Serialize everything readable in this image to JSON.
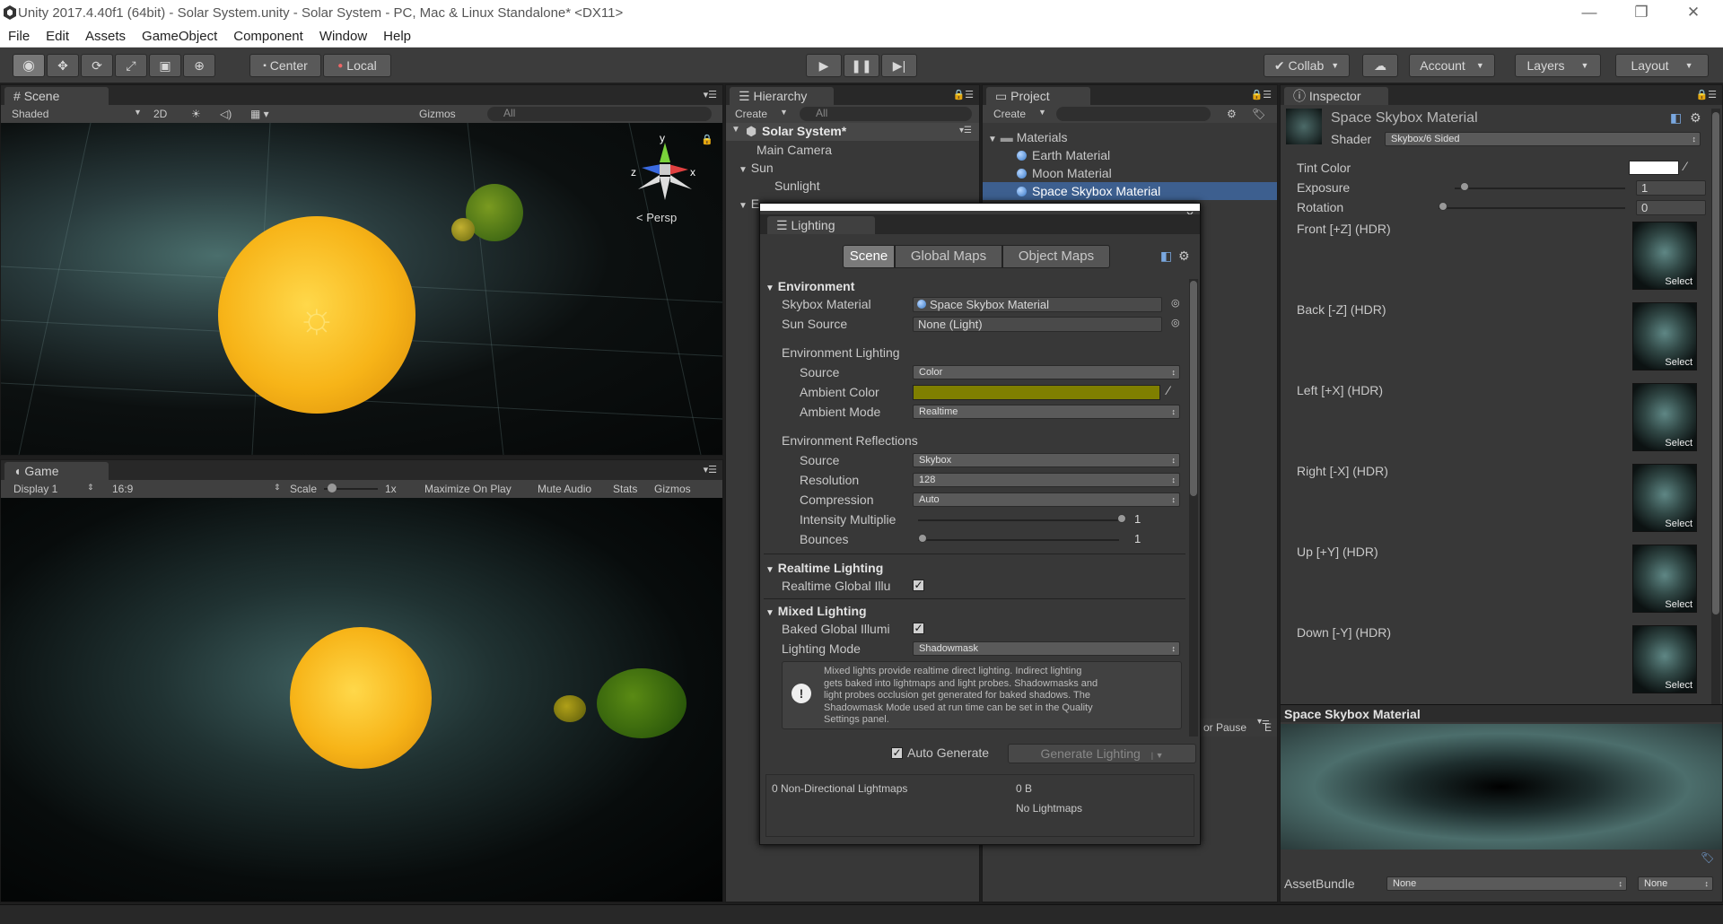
{
  "window": {
    "title": "Unity 2017.4.40f1 (64bit) - Solar System.unity - Solar System - PC, Mac & Linux Standalone* <DX11>",
    "minimize_glyph": "—",
    "restore_glyph": "❐",
    "close_glyph": "✕"
  },
  "menu": [
    "File",
    "Edit",
    "Assets",
    "GameObject",
    "Component",
    "Window",
    "Help"
  ],
  "toolbar": {
    "center_label": "Center",
    "local_label": "Local",
    "collab_label": "Collab",
    "account_label": "Account",
    "layers_label": "Layers",
    "layout_label": "Layout"
  },
  "scene_view": {
    "tab": "Scene",
    "shading": "Shaded",
    "mode_2d": "2D",
    "gizmos": "Gizmos",
    "search_placeholder": "All",
    "persp_label": "Persp",
    "gizmo_axes": [
      "y",
      "x",
      "z"
    ]
  },
  "game_view": {
    "tab": "Game",
    "display": "Display 1",
    "aspect": "16:9",
    "scale_label": "Scale",
    "scale_value": "1x",
    "maximize_on_play": "Maximize On Play",
    "mute_audio": "Mute Audio",
    "stats": "Stats",
    "gizmos": "Gizmos"
  },
  "hierarchy": {
    "tab": "Hierarchy",
    "create": "Create",
    "search_placeholder": "All",
    "scene_name": "Solar System*",
    "items": [
      "Main Camera",
      "Sun",
      "Sunlight",
      "E"
    ]
  },
  "project": {
    "tab": "Project",
    "create": "Create",
    "folder": "Materials",
    "items": [
      "Earth Material",
      "Moon Material",
      "Space Skybox Material"
    ]
  },
  "console_fragment": {
    "error_pause": "or Pause",
    "editor": "E"
  },
  "lighting": {
    "title": "Lighting",
    "tabs": [
      "Scene",
      "Global Maps",
      "Object Maps"
    ],
    "active_tab": 0,
    "environment": {
      "header": "Environment",
      "skybox_label": "Skybox Material",
      "skybox_value": "Space Skybox Material",
      "sun_label": "Sun Source",
      "sun_value": "None (Light)",
      "env_lighting_header": "Environment Lighting",
      "source_label": "Source",
      "source_value": "Color",
      "ambient_color_label": "Ambient Color",
      "ambient_color": "#7f7f00",
      "ambient_mode_label": "Ambient Mode",
      "ambient_mode_value": "Realtime",
      "env_reflections_header": "Environment Reflections",
      "refl_source_label": "Source",
      "refl_source_value": "Skybox",
      "resolution_label": "Resolution",
      "resolution_value": "128",
      "compression_label": "Compression",
      "compression_value": "Auto",
      "intensity_label": "Intensity Multiplie",
      "intensity_value": "1",
      "bounces_label": "Bounces",
      "bounces_value": "1"
    },
    "realtime": {
      "header": "Realtime Lighting",
      "gi_label": "Realtime Global Illu",
      "gi_checked": true
    },
    "mixed": {
      "header": "Mixed Lighting",
      "baked_label": "Baked Global Illumi",
      "baked_checked": true,
      "mode_label": "Lighting Mode",
      "mode_value": "Shadowmask",
      "help_lines": [
        "Mixed lights provide realtime direct lighting. Indirect lighting",
        "gets baked into lightmaps and light probes. Shadowmasks and",
        "light probes occlusion get generated for baked shadows. The",
        "Shadowmask Mode used at run time can be set in the Quality",
        "Settings panel."
      ]
    },
    "auto_generate_label": "Auto Generate",
    "auto_generate_checked": true,
    "generate_button": "Generate Lighting",
    "lightmaps_label": "0 Non-Directional Lightmaps",
    "lightmaps_size": "0 B",
    "no_lightmaps": "No Lightmaps"
  },
  "inspector": {
    "tab": "Inspector",
    "material_name": "Space Skybox Material",
    "shader_label": "Shader",
    "shader_value": "Skybox/6 Sided",
    "tint_label": "Tint Color",
    "exposure_label": "Exposure",
    "exposure_value": "1",
    "rotation_label": "Rotation",
    "rotation_value": "0",
    "faces": [
      "Front [+Z]   (HDR)",
      "Back [-Z]   (HDR)",
      "Left [+X]   (HDR)",
      "Right [-X]   (HDR)",
      "Up [+Y]   (HDR)",
      "Down [-Y]   (HDR)"
    ],
    "select_label": "Select",
    "preview_title": "Space Skybox Material",
    "assetbundle_label": "AssetBundle",
    "assetbundle_value": "None",
    "assetbundle_variant": "None"
  }
}
